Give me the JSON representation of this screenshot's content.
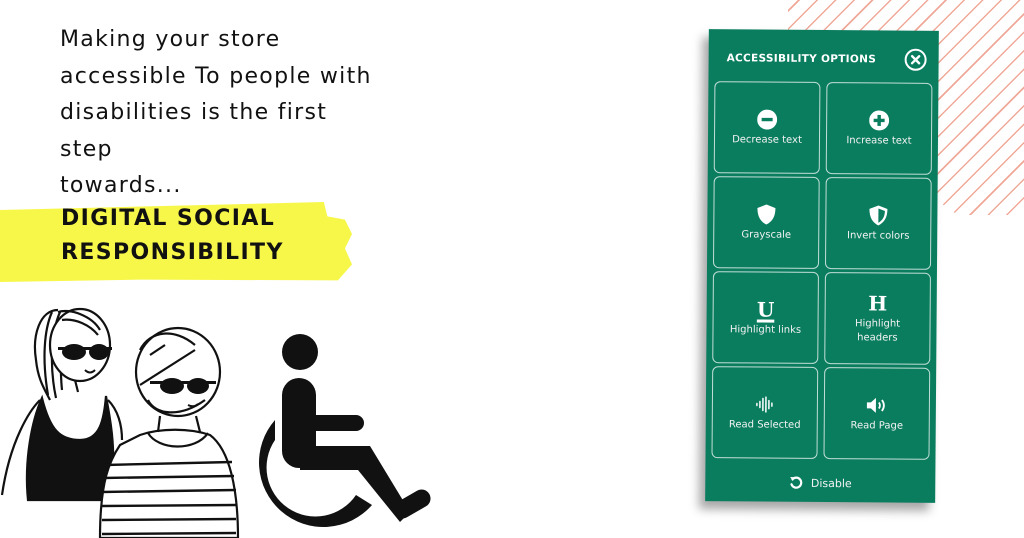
{
  "headline": {
    "lines": [
      "Making your store",
      "accessible To people with",
      "disabilities is the first",
      "step",
      "towards..."
    ],
    "highlight_lines": [
      "DIGITAL SOCIAL",
      "RESPONSIBILITY"
    ],
    "highlight_color": "#f7f74a"
  },
  "illustration": {
    "figures": [
      "woman-with-ponytail-and-sunglasses",
      "woman-with-bob-and-sunglasses",
      "wheelchair-symbol"
    ]
  },
  "panel": {
    "title": "ACCESSIBILITY OPTIONS",
    "close_icon": "close-circle-icon",
    "background_color": "#0a7d5f",
    "options": [
      {
        "label": "Decrease text",
        "icon": "minus-circle-icon"
      },
      {
        "label": "Increase text",
        "icon": "plus-circle-icon"
      },
      {
        "label": "Grayscale",
        "icon": "shield-icon"
      },
      {
        "label": "Invert colors",
        "icon": "half-shield-icon"
      },
      {
        "label": "Highlight links",
        "icon": "underline-icon",
        "glyph": "U"
      },
      {
        "label": "Highlight headers",
        "icon": "header-icon",
        "glyph": "H"
      },
      {
        "label": "Read Selected",
        "icon": "soundwave-icon"
      },
      {
        "label": "Read Page",
        "icon": "speaker-icon"
      }
    ],
    "disable": {
      "label": "Disable",
      "icon": "undo-icon"
    }
  },
  "decor": {
    "hatch_color": "#f0a898"
  }
}
